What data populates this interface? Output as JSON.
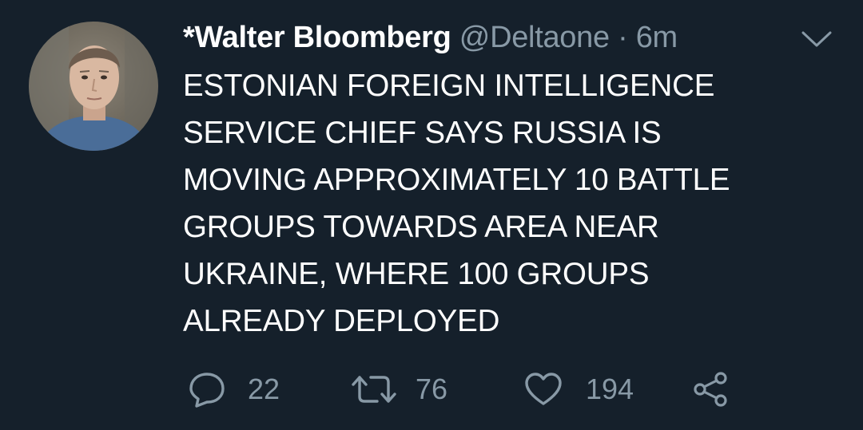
{
  "tweet": {
    "author_name": "*Walter Bloomberg",
    "handle": "@Deltaone",
    "separator": "·",
    "time_ago": "6m",
    "text_lines": [
      "ESTONIAN FOREIGN INTELLIGENCE",
      "SERVICE CHIEF SAYS RUSSIA IS",
      "MOVING APPROXIMATELY 10 BATTLE",
      "GROUPS TOWARDS AREA NEAR",
      "UKRAINE, WHERE 100 GROUPS",
      "ALREADY DEPLOYED"
    ]
  },
  "actions": {
    "reply": {
      "icon": "reply-icon",
      "count": "22"
    },
    "retweet": {
      "icon": "retweet-icon",
      "count": "76"
    },
    "like": {
      "icon": "heart-icon",
      "count": "194"
    },
    "share": {
      "icon": "share-icon"
    }
  },
  "colors": {
    "background": "#15202b",
    "text_primary": "#ffffff",
    "text_secondary": "#8899a6"
  }
}
